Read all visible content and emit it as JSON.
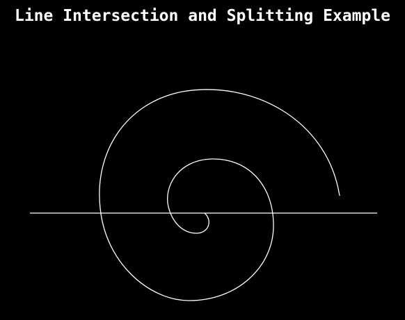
{
  "window": {
    "title": "Line Intersection and Splitting Example"
  },
  "scene": {
    "background_color": "#000000",
    "stroke_color": "#ffffff",
    "shapes": [
      "spiral",
      "horizontal-line"
    ]
  }
}
